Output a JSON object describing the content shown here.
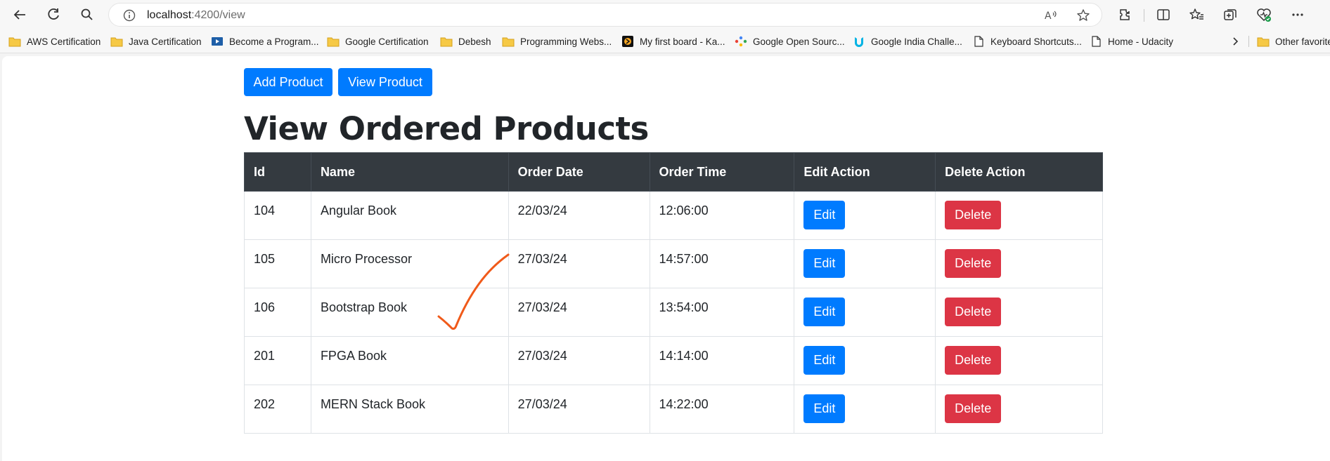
{
  "browser": {
    "url_host": "localhost",
    "url_rest": ":4200/view",
    "bookmarks": [
      {
        "label": "AWS Certification",
        "icon": "folder-icon"
      },
      {
        "label": "Java Certification",
        "icon": "folder-icon"
      },
      {
        "label": "Become a Program...",
        "icon": "video-icon"
      },
      {
        "label": "Google Certification",
        "icon": "folder-icon"
      },
      {
        "label": "Debesh",
        "icon": "folder-icon"
      },
      {
        "label": "Programming Webs...",
        "icon": "folder-icon"
      },
      {
        "label": "My first board - Ka...",
        "icon": "kaggle-board-icon"
      },
      {
        "label": "Google Open Sourc...",
        "icon": "google-open-source-icon"
      },
      {
        "label": "Google India Challe...",
        "icon": "udacity-icon"
      },
      {
        "label": "Keyboard Shortcuts...",
        "icon": "page-icon"
      },
      {
        "label": "Home - Udacity",
        "icon": "page-icon"
      }
    ],
    "other_favorites": "Other favorites"
  },
  "toolbar": {
    "add_product_label": "Add Product",
    "view_product_label": "View Product"
  },
  "page": {
    "title": "View Ordered Products"
  },
  "table": {
    "headers": [
      "Id",
      "Name",
      "Order Date",
      "Order Time",
      "Edit Action",
      "Delete Action"
    ],
    "edit_label": "Edit",
    "delete_label": "Delete",
    "rows": [
      {
        "id": "104",
        "name": "Angular Book",
        "date": "22/03/24",
        "time": "12:06:00"
      },
      {
        "id": "105",
        "name": "Micro Processor",
        "date": "27/03/24",
        "time": "14:57:00"
      },
      {
        "id": "106",
        "name": "Bootstrap Book",
        "date": "27/03/24",
        "time": "13:54:00"
      },
      {
        "id": "201",
        "name": "FPGA Book",
        "date": "27/03/24",
        "time": "14:14:00"
      },
      {
        "id": "202",
        "name": "MERN Stack Book",
        "date": "27/03/24",
        "time": "14:22:00"
      }
    ]
  },
  "colors": {
    "primary": "#007bff",
    "danger": "#dc3545",
    "table_header": "#343a40",
    "checkmark": "#f05a1a"
  }
}
